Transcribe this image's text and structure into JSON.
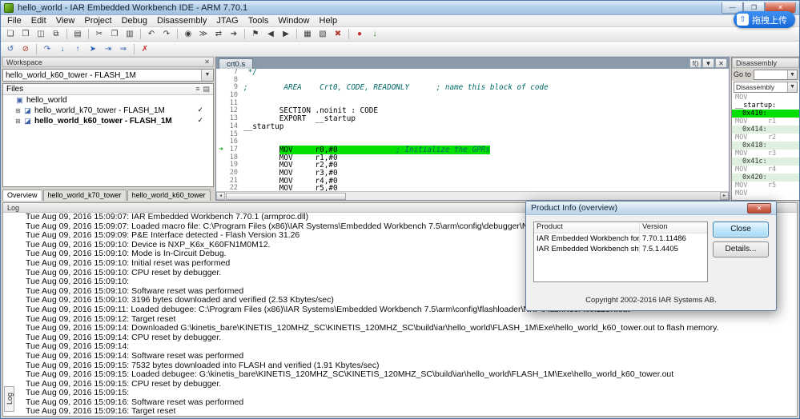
{
  "window": {
    "title": "hello_world - IAR Embedded Workbench IDE - ARM 7.70.1",
    "minimize": "—",
    "maximize": "❐",
    "close": "✕"
  },
  "glyphs": {
    "dropdown": "▼",
    "check": "✓",
    "current_arrow": "➜",
    "scroll_left": "◂",
    "scroll_right": "▸"
  },
  "colors": {
    "debug_highlight_green": "#00e000",
    "upload_button_blue": "#1f7ae0"
  },
  "menu": {
    "items": [
      "File",
      "Edit",
      "View",
      "Project",
      "Debug",
      "Disassembly",
      "JTAG",
      "Tools",
      "Window",
      "Help"
    ]
  },
  "toolbar_main": {
    "icons": [
      {
        "n": "new-document",
        "g": "❏"
      },
      {
        "n": "open-file",
        "g": "❒"
      },
      {
        "n": "save",
        "g": "◫"
      },
      {
        "n": "save-all",
        "g": "⧉"
      },
      {
        "sep": true
      },
      {
        "n": "print",
        "g": "▤"
      },
      {
        "sep": true
      },
      {
        "n": "cut",
        "g": "✂"
      },
      {
        "n": "copy",
        "g": "❐"
      },
      {
        "n": "paste",
        "g": "▥"
      },
      {
        "sep": true
      },
      {
        "n": "undo",
        "g": "↶"
      },
      {
        "n": "redo",
        "g": "↷"
      },
      {
        "sep": true
      },
      {
        "n": "find",
        "g": "◉"
      },
      {
        "n": "find-next",
        "g": "≫"
      },
      {
        "n": "replace",
        "g": "⇄"
      },
      {
        "n": "go-to",
        "g": "➔"
      },
      {
        "sep": true
      },
      {
        "n": "toggle-bookmark",
        "g": "⚑"
      },
      {
        "n": "previous-bookmark",
        "g": "◀"
      },
      {
        "n": "next-bookmark",
        "g": "▶"
      },
      {
        "sep": true
      },
      {
        "n": "make",
        "g": "▦"
      },
      {
        "n": "compile",
        "g": "▧"
      },
      {
        "n": "stop-build",
        "g": "✖",
        "c": "#b23b2e"
      },
      {
        "sep": true
      },
      {
        "n": "toggle-breakpoint",
        "g": "●",
        "c": "#c03030"
      },
      {
        "n": "download-and-debug",
        "g": "↓",
        "c": "#2a7d2a"
      }
    ]
  },
  "toolbar_debug": {
    "icons": [
      {
        "n": "reset",
        "g": "↺",
        "c": "#2f5fb3"
      },
      {
        "n": "break",
        "g": "⊘",
        "c": "#b23b2e"
      },
      {
        "sep": true
      },
      {
        "n": "step-over",
        "g": "↷",
        "c": "#2f5fb3"
      },
      {
        "n": "step-into",
        "g": "↓",
        "c": "#2f5fb3"
      },
      {
        "n": "step-out",
        "g": "↑",
        "c": "#2f5fb3"
      },
      {
        "n": "next-statement",
        "g": "➤",
        "c": "#2f5fb3"
      },
      {
        "n": "run-to-cursor",
        "g": "⇥",
        "c": "#2f5fb3"
      },
      {
        "n": "go",
        "g": "⇒",
        "c": "#2f5fb3"
      },
      {
        "sep": true
      },
      {
        "n": "stop-debugging",
        "g": "✗",
        "c": "#c03030"
      }
    ]
  },
  "upload": {
    "label": "拖拽上传",
    "icon": "⇧"
  },
  "workspace": {
    "title": "Workspace",
    "close_glyph": "✕",
    "config": "hello_world_k60_tower - FLASH_1M",
    "files_header": "Files",
    "filter_icon": "≡",
    "columns_icon": "▤",
    "tree": [
      {
        "label": "hello_world",
        "level": 0,
        "icon": "▣",
        "expander": "",
        "bold": false,
        "checked": false
      },
      {
        "label": "hello_world_k70_tower - FLASH_1M",
        "level": 1,
        "icon": "◪",
        "expander": "⊞",
        "bold": false,
        "checked": true
      },
      {
        "label": "hello_world_k60_tower - FLASH_1M",
        "level": 1,
        "icon": "◪",
        "expander": "⊞",
        "bold": true,
        "checked": true
      }
    ],
    "tabs": [
      "Overview",
      "hello_world_k70_tower",
      "hello_world_k60_tower"
    ]
  },
  "editor": {
    "tab": "crt0.s",
    "fn_button": "f()",
    "close_glyph": "✕",
    "lines": [
      {
        "num": "7",
        "lead": "",
        "code": "",
        "comment": " */"
      },
      {
        "num": "8",
        "lead": "",
        "code": "",
        "comment": ""
      },
      {
        "num": "9",
        "lead": "",
        "code": "",
        "comment": ";        AREA    Crt0, CODE, READONLY      ; name this block of code"
      },
      {
        "num": "10",
        "lead": "",
        "code": "",
        "comment": ""
      },
      {
        "num": "11",
        "lead": "",
        "code": "",
        "comment": ""
      },
      {
        "num": "12",
        "lead": "        ",
        "code": "SECTION .noinit : CODE",
        "comment": ""
      },
      {
        "num": "13",
        "lead": "        ",
        "code": "EXPORT  __startup",
        "comment": ""
      },
      {
        "num": "14",
        "lead": "",
        "code": "__startup",
        "comment": ""
      },
      {
        "num": "15",
        "lead": "",
        "code": "",
        "comment": ""
      },
      {
        "num": "16",
        "lead": "",
        "code": "",
        "comment": ""
      },
      {
        "num": "17",
        "lead": "        ",
        "code": "MOV     r0,#0",
        "comment": "             ; Initialize the GPRs",
        "current": true
      },
      {
        "num": "18",
        "lead": "        ",
        "code": "MOV     r1,#0",
        "comment": ""
      },
      {
        "num": "19",
        "lead": "        ",
        "code": "MOV     r2,#0",
        "comment": ""
      },
      {
        "num": "20",
        "lead": "        ",
        "code": "MOV     r3,#0",
        "comment": ""
      },
      {
        "num": "21",
        "lead": "        ",
        "code": "MOV     r4,#0",
        "comment": ""
      },
      {
        "num": "22",
        "lead": "        ",
        "code": "MOV     r5,#0",
        "comment": ""
      }
    ]
  },
  "disassembly": {
    "title": "Disassembly",
    "goto_label": "Go to",
    "context": "Disassembly",
    "rows": [
      {
        "t": "MOV",
        "y": "dim"
      },
      {
        "t": "__startup:",
        "y": "label"
      },
      {
        "t": "0x410:",
        "y": "current"
      },
      {
        "t": "MOV     r1",
        "y": "dim"
      },
      {
        "t": "0x414:",
        "y": "addr"
      },
      {
        "t": "MOV     r2",
        "y": "dim"
      },
      {
        "t": "0x418:",
        "y": "addr"
      },
      {
        "t": "MOV     r3",
        "y": "dim"
      },
      {
        "t": "0x41c:",
        "y": "addr"
      },
      {
        "t": "MOV     r4",
        "y": "dim"
      },
      {
        "t": "0x420:",
        "y": "addr"
      },
      {
        "t": "MOV     r5",
        "y": "dim"
      },
      {
        "t": "MOV",
        "y": "dim"
      }
    ]
  },
  "log": {
    "tab_label": "Log",
    "header": "Log",
    "lines": [
      "Tue Aug 09, 2016 15:09:07: IAR Embedded Workbench 7.70.1 (armproc.dll)",
      "Tue Aug 09, 2016 15:09:07: Loaded macro file: C:\\Program Files (x86)\\IAR Systems\\Embedded Workbench 7.5\\arm\\config\\debugger\\NXP\\Kxx.dmac",
      "Tue Aug 09, 2016 15:09:09: P&E Interface detected - Flash Version 31.26",
      "Tue Aug 09, 2016 15:09:10: Device is NXP_K6x_K60FN1M0M12.",
      "Tue Aug 09, 2016 15:09:10: Mode is In-Circuit Debug.",
      "Tue Aug 09, 2016 15:09:10: Initial reset was performed",
      "Tue Aug 09, 2016 15:09:10: CPU reset by debugger.",
      "Tue Aug 09, 2016 15:09:10:",
      "Tue Aug 09, 2016 15:09:10: Software reset was performed",
      "Tue Aug 09, 2016 15:09:10: 3196 bytes downloaded and verified (2.53 Kbytes/sec)",
      "Tue Aug 09, 2016 15:09:11: Loaded debugee: C:\\Program Files (x86)\\IAR Systems\\Embedded Workbench 7.5\\arm\\config\\flashloader\\NXP\\FlashK60Fxxx128K.out",
      "Tue Aug 09, 2016 15:09:12: Target reset",
      "Tue Aug 09, 2016 15:09:14: Downloaded G:\\kinetis_bare\\KINETIS_120MHZ_SC\\KINETIS_120MHZ_SC\\build\\iar\\hello_world\\FLASH_1M\\Exe\\hello_world_k60_tower.out to flash memory.",
      "Tue Aug 09, 2016 15:09:14: CPU reset by debugger.",
      "Tue Aug 09, 2016 15:09:14:",
      "Tue Aug 09, 2016 15:09:14: Software reset was performed",
      "Tue Aug 09, 2016 15:09:15: 7532 bytes downloaded into FLASH and verified (1.91 Kbytes/sec)",
      "Tue Aug 09, 2016 15:09:15: Loaded debugee: G:\\kinetis_bare\\KINETIS_120MHZ_SC\\KINETIS_120MHZ_SC\\build\\iar\\hello_world\\FLASH_1M\\Exe\\hello_world_k60_tower.out",
      "Tue Aug 09, 2016 15:09:15: CPU reset by debugger.",
      "Tue Aug 09, 2016 15:09:15:",
      "Tue Aug 09, 2016 15:09:16: Software reset was performed",
      "Tue Aug 09, 2016 15:09:16: Target reset"
    ]
  },
  "dialog": {
    "title": "Product Info (overview)",
    "close_glyph": "✕",
    "col_product": "Product",
    "col_version": "Version",
    "rows": [
      {
        "product": "IAR Embedded Workbench for ARM",
        "version": "7.70.1.11486"
      },
      {
        "product": "IAR Embedded Workbench shared components",
        "version": "7.5.1.4405"
      }
    ],
    "close_button": "Close",
    "details_button": "Details...",
    "copyright": "Copyright 2002-2016 IAR Systems AB."
  }
}
